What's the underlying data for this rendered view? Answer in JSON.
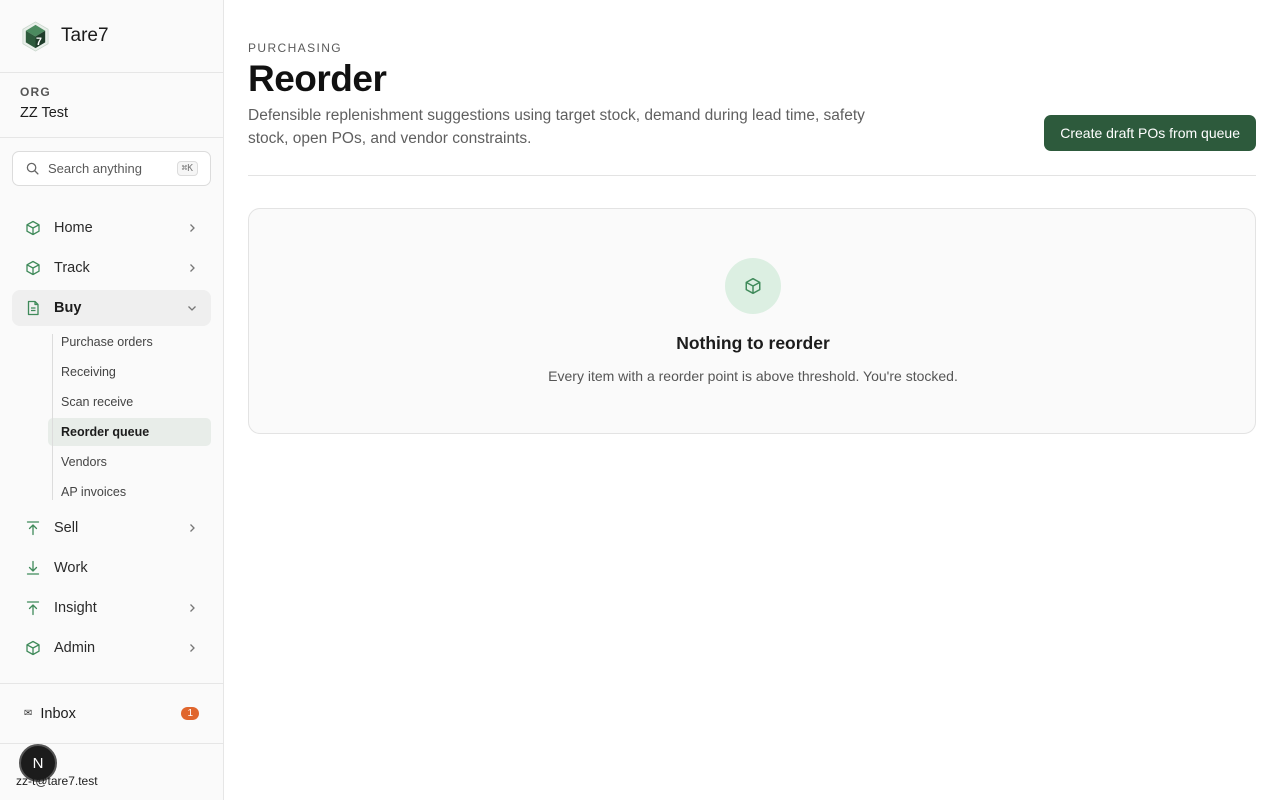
{
  "brand": {
    "name": "Tare7",
    "icon": "hexagon-logo-icon"
  },
  "org": {
    "label": "ORG",
    "name": "ZZ Test"
  },
  "search": {
    "placeholder": "Search anything",
    "shortcut": "⌘K"
  },
  "sidebar": {
    "items": [
      {
        "label": "Home",
        "icon": "box-icon",
        "expandable": true
      },
      {
        "label": "Track",
        "icon": "box-icon",
        "expandable": true
      },
      {
        "label": "Buy",
        "icon": "document-icon",
        "expanded": true,
        "active": true
      },
      {
        "label": "Sell",
        "icon": "arrow-up-icon",
        "expandable": true
      },
      {
        "label": "Work",
        "icon": "arrow-down-icon",
        "expandable": false
      },
      {
        "label": "Insight",
        "icon": "arrow-up-icon",
        "expandable": true
      },
      {
        "label": "Admin",
        "icon": "box-icon",
        "expandable": true
      }
    ],
    "buy_subitems": [
      {
        "label": "Purchase orders"
      },
      {
        "label": "Receiving"
      },
      {
        "label": "Scan receive"
      },
      {
        "label": "Reorder queue",
        "active": true
      },
      {
        "label": "Vendors"
      },
      {
        "label": "AP invoices"
      }
    ]
  },
  "inbox": {
    "label": "Inbox",
    "count": "1",
    "icon": "mail-icon"
  },
  "user": {
    "avatar_initial": "N",
    "email": "zz-t@tare7.test"
  },
  "page": {
    "eyebrow": "PURCHASING",
    "title": "Reorder",
    "description": "Defensible replenishment suggestions using target stock, demand during lead time, safety stock, open POs, and vendor constraints.",
    "primary_action": "Create draft POs from queue"
  },
  "empty_state": {
    "icon": "box-icon",
    "title": "Nothing to reorder",
    "message": "Every item with a reorder point is above threshold. You're stocked."
  },
  "colors": {
    "accent": "#2d5a3c",
    "icon_green": "#3f8a5a",
    "badge": "#e0662d",
    "empty_icon_bg": "#dcefe2"
  }
}
